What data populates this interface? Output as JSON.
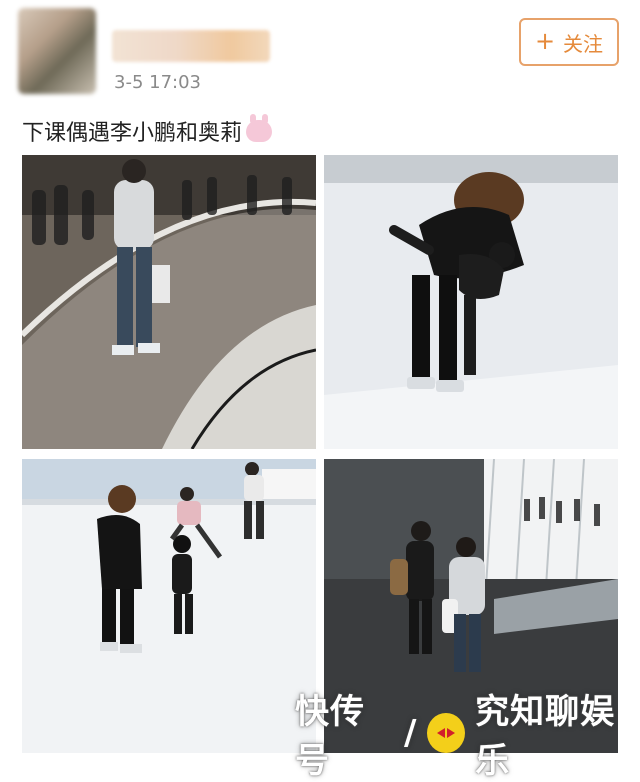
{
  "post": {
    "timestamp": "3-5 17:03",
    "follow_label": "关注",
    "text": "下课偶遇李小鹏和奥莉"
  },
  "watermark": {
    "part1": "快传号",
    "slash": "/",
    "part2": "究知聊娱乐"
  },
  "colors": {
    "follow_orange": "#e58a3b",
    "timestamp_gray": "#8a8a8a",
    "text_dark": "#222222"
  },
  "icons": [
    "avatar-blurred",
    "plus-icon",
    "rabbit-emoji-icon",
    "watermark-logo-icon"
  ]
}
